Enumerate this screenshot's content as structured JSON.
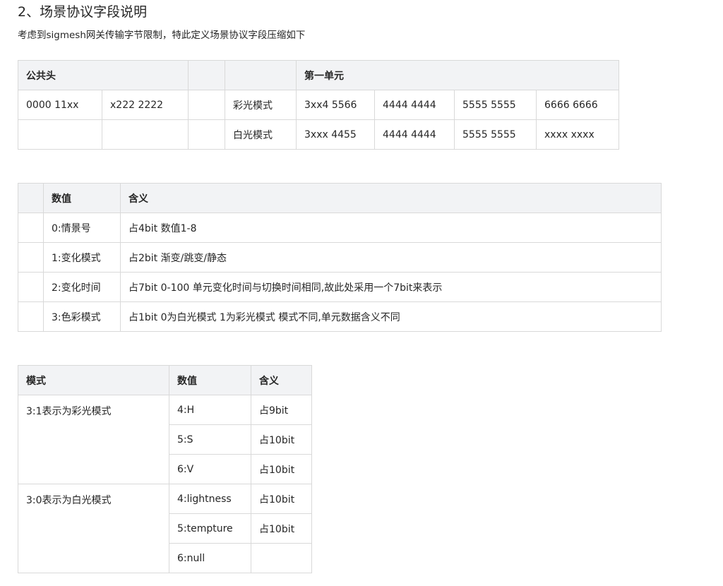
{
  "title": "2、场景协议字段说明",
  "intro": "考虑到sigmesh网关传输字节限制，特此定义场景协议字段压缩如下",
  "table1": {
    "header": {
      "common_head": "公共头",
      "first_unit": "第一单元"
    },
    "row1": [
      "0000 11xx",
      "x222 2222",
      "",
      "彩光模式",
      "3xx4 5566",
      "4444 4444",
      "5555 5555",
      "6666 6666"
    ],
    "row2": [
      "",
      "",
      "",
      "白光模式",
      "3xxx 4455",
      "4444 4444",
      "5555 5555",
      "xxxx xxxx"
    ]
  },
  "table2": {
    "headers": [
      "",
      "数值",
      "含义"
    ],
    "rows": [
      [
        "",
        "0:情景号",
        "占4bit 数值1-8"
      ],
      [
        "",
        "1:变化模式",
        "占2bit 渐变/跳变/静态"
      ],
      [
        "",
        "2:变化时间",
        "占7bit 0-100 单元变化时间与切换时间相同,故此处采用一个7bit来表示"
      ],
      [
        "",
        "3:色彩模式",
        "占1bit 0为白光模式 1为彩光模式 模式不同,单元数据含义不同"
      ]
    ]
  },
  "table3": {
    "headers": [
      "模式",
      "数值",
      "含义"
    ],
    "groups": [
      {
        "mode": "3:1表示为彩光模式",
        "rows": [
          [
            "4:H",
            "占9bit"
          ],
          [
            "5:S",
            "占10bit"
          ],
          [
            "6:V",
            "占10bit"
          ]
        ]
      },
      {
        "mode": "3:0表示为白光模式",
        "rows": [
          [
            "4:lightness",
            "占10bit"
          ],
          [
            "5:tempture",
            "占10bit"
          ],
          [
            "6:null",
            ""
          ]
        ]
      }
    ]
  }
}
